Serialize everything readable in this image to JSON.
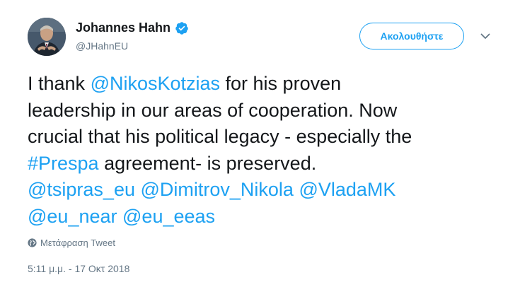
{
  "author": {
    "name": "Johannes Hahn",
    "handle": "@JHahnEU",
    "verified": true
  },
  "follow_button": {
    "label": "Ακολουθήστε"
  },
  "tweet": {
    "lines": [
      [
        {
          "text": "I thank ",
          "type": "text"
        },
        {
          "text": "@NikosKotzias",
          "type": "mention"
        },
        {
          "text": " for his proven",
          "type": "text"
        }
      ],
      [
        {
          "text": "leadership in our areas of cooperation. Now",
          "type": "text"
        }
      ],
      [
        {
          "text": "crucial that his political legacy - especially the",
          "type": "text"
        }
      ],
      [
        {
          "text": "#Prespa",
          "type": "hashtag"
        },
        {
          "text": " agreement- is preserved.",
          "type": "text"
        }
      ],
      [
        {
          "text": "@tsipras_eu",
          "type": "mention"
        },
        {
          "text": " ",
          "type": "text"
        },
        {
          "text": "@Dimitrov_Nikola",
          "type": "mention"
        },
        {
          "text": " ",
          "type": "text"
        },
        {
          "text": "@VladaMK",
          "type": "mention"
        }
      ],
      [
        {
          "text": "@eu_near",
          "type": "mention"
        },
        {
          "text": " ",
          "type": "text"
        },
        {
          "text": "@eu_eeas",
          "type": "mention"
        }
      ]
    ]
  },
  "translate_label": "Μετάφραση Tweet",
  "timestamp": "5:11 μ.μ. - 17 Οκτ 2018",
  "colors": {
    "link": "#1da1f2",
    "text": "#14171a",
    "muted": "#657786"
  },
  "icons": {
    "verified": "verified-badge-icon",
    "caret": "chevron-down-icon",
    "translate": "globe-icon"
  }
}
